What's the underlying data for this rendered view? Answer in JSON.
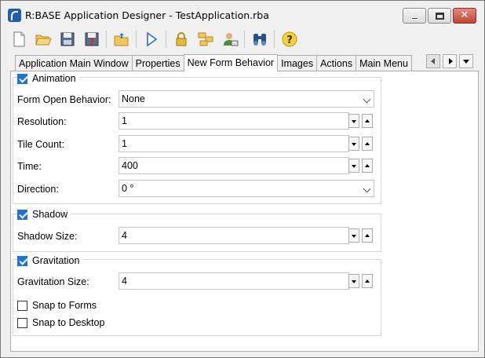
{
  "window": {
    "title": "R:BASE Application Designer - TestApplication.rba",
    "minimize_glyph": "",
    "maximize_glyph": "",
    "close_glyph": "✕"
  },
  "toolbar": {
    "buttons": [
      {
        "icon": "new-file-icon"
      },
      {
        "icon": "open-folder-icon"
      },
      {
        "icon": "save-icon"
      },
      {
        "icon": "save-as-icon"
      },
      {
        "icon": "folder-up-icon"
      },
      {
        "icon": "run-icon"
      },
      {
        "icon": "lock-icon"
      },
      {
        "icon": "structure-icon"
      },
      {
        "icon": "user-icon"
      },
      {
        "icon": "binoculars-icon"
      },
      {
        "icon": "help-icon"
      }
    ]
  },
  "tabs": [
    {
      "label": "Application Main Window",
      "active": false
    },
    {
      "label": "Properties",
      "active": false
    },
    {
      "label": "New Form Behavior",
      "active": true
    },
    {
      "label": "Images",
      "active": false
    },
    {
      "label": "Actions",
      "active": false
    },
    {
      "label": "Main Menu",
      "active": false
    }
  ],
  "animation": {
    "label": "Animation",
    "checked": true,
    "form_open_behavior": {
      "label": "Form Open Behavior:",
      "value": "None"
    },
    "resolution": {
      "label": "Resolution:",
      "value": "1"
    },
    "tile_count": {
      "label": "Tile Count:",
      "value": "1"
    },
    "time": {
      "label": "Time:",
      "value": "400"
    },
    "direction": {
      "label": "Direction:",
      "value": "0 °"
    }
  },
  "shadow": {
    "label": "Shadow",
    "checked": true,
    "size": {
      "label": "Shadow Size:",
      "value": "4"
    }
  },
  "gravitation": {
    "label": "Gravitation",
    "checked": true,
    "size": {
      "label": "Gravitation Size:",
      "value": "4"
    },
    "snap_forms": {
      "label": "Snap to Forms",
      "checked": false
    },
    "snap_desktop": {
      "label": "Snap to Desktop",
      "checked": false
    }
  },
  "colors": {
    "accent": "#1f74d3",
    "close_button": "#c44433"
  }
}
